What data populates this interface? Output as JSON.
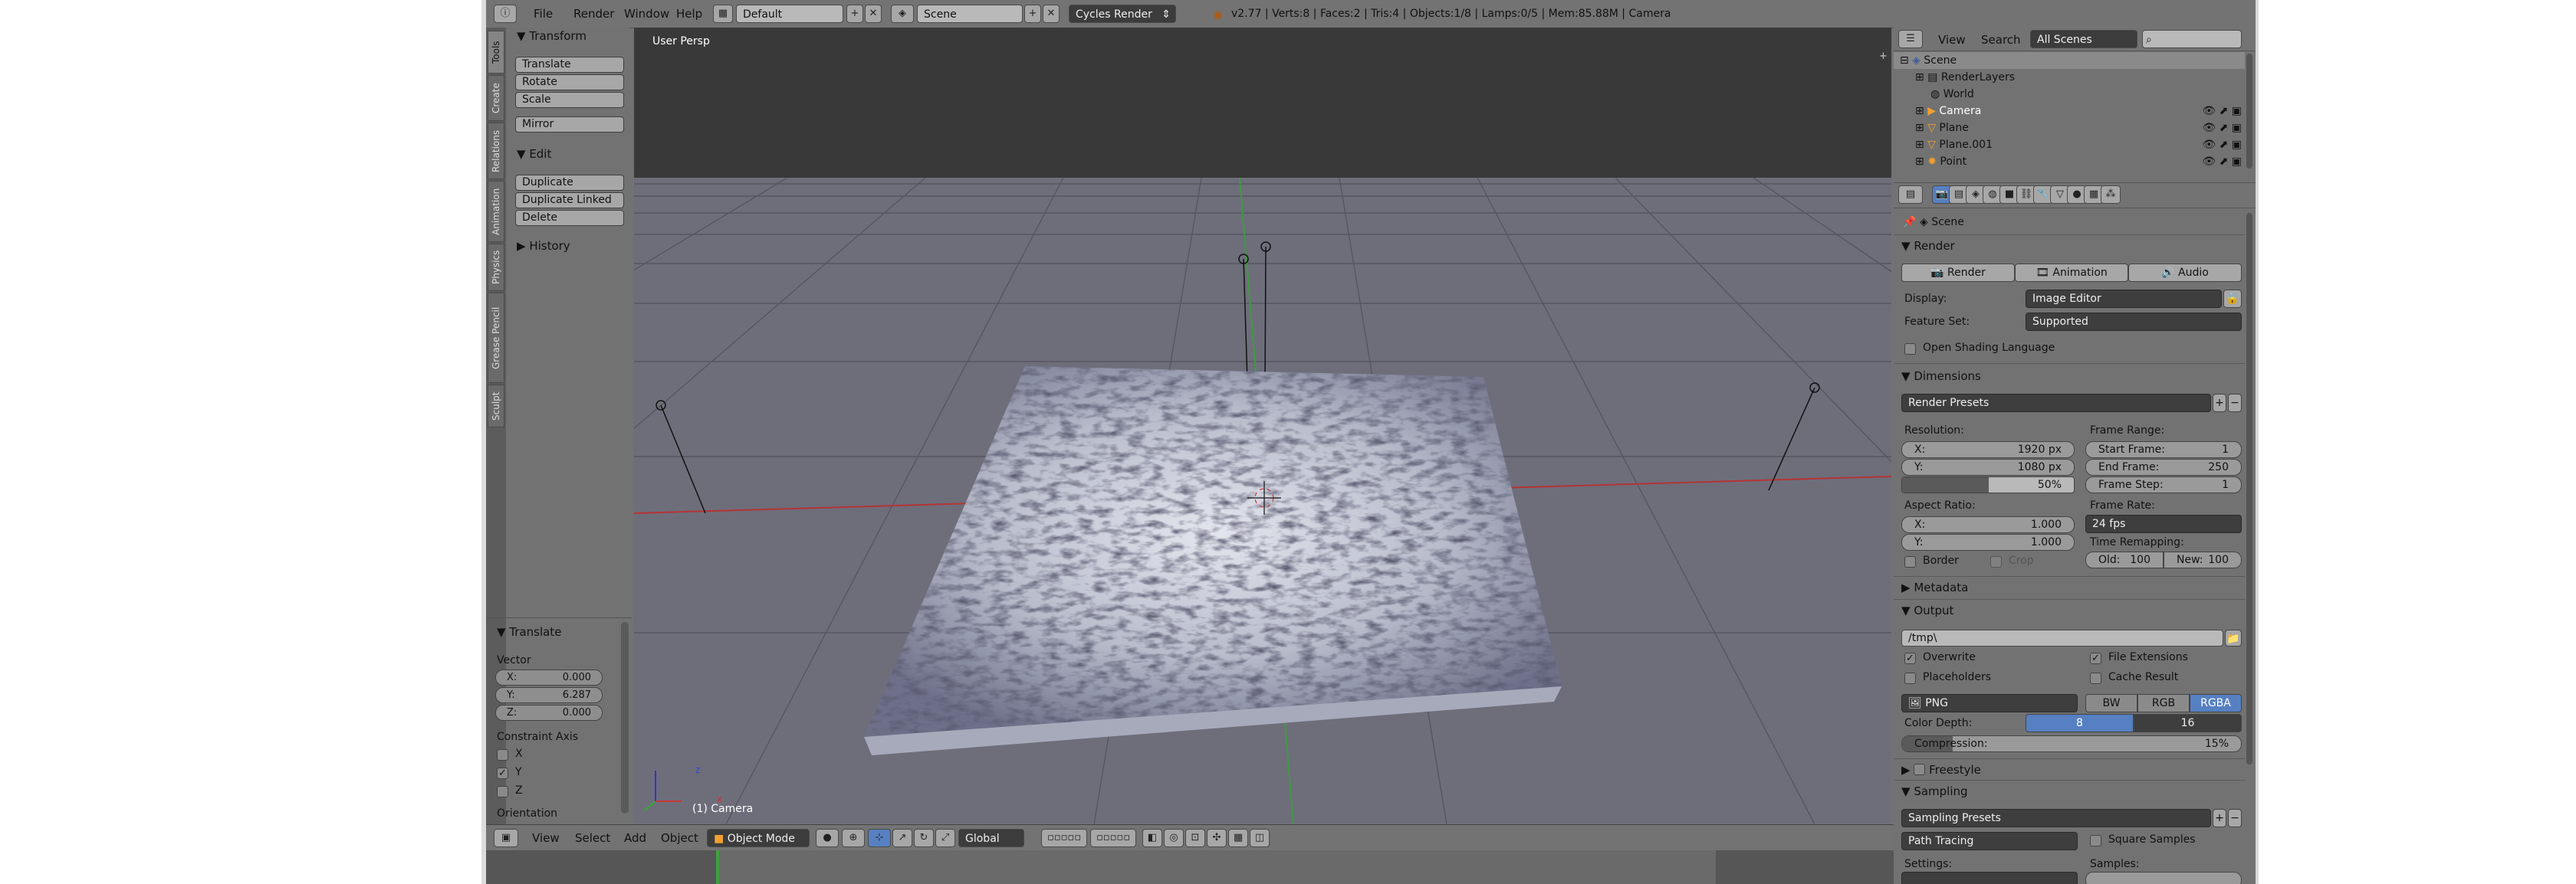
{
  "topbar": {
    "menus": [
      "File",
      "Render",
      "Window",
      "Help"
    ],
    "layout": "Default",
    "scene": "Scene",
    "engine": "Cycles Render",
    "stats": "v2.77 | Verts:8 | Faces:2 | Tris:4 | Objects:1/8 | Lamps:0/5 | Mem:85.88M | Camera"
  },
  "toolshelf": {
    "tabs": [
      "Tools",
      "Create",
      "Relations",
      "Animation",
      "Physics",
      "Grease Pencil",
      "Sculpt"
    ],
    "transform_header": "Transform",
    "transform_buttons": [
      "Translate",
      "Rotate",
      "Scale"
    ],
    "mirror": "Mirror",
    "edit_header": "Edit",
    "edit_buttons": [
      "Duplicate",
      "Duplicate Linked",
      "Delete"
    ],
    "history_header": "History"
  },
  "operator": {
    "header": "Translate",
    "vector_label": "Vector",
    "x_label": "X:",
    "x_value": "0.000",
    "y_label": "Y:",
    "y_value": "6.287",
    "z_label": "Z:",
    "z_value": "0.000",
    "constraint_label": "Constraint Axis",
    "axes": [
      "X",
      "Y",
      "Z"
    ],
    "orientation_label": "Orientation"
  },
  "viewport": {
    "view_name": "User Persp",
    "object_label": "(1) Camera",
    "axis_x": "x",
    "axis_z": "z"
  },
  "header3d": {
    "menus": [
      "View",
      "Select",
      "Add",
      "Object"
    ],
    "mode": "Object Mode",
    "orientation": "Global"
  },
  "outliner": {
    "menus": [
      "View",
      "Search"
    ],
    "filter": "All Scenes",
    "rows": [
      "Scene",
      "RenderLayers",
      "World",
      "Camera",
      "Plane",
      "Plane.001",
      "Point"
    ]
  },
  "properties": {
    "scene_label": "Scene",
    "render_header": "Render",
    "render_btn": "Render",
    "animation_btn": "Animation",
    "audio_btn": "Audio",
    "display_label": "Display:",
    "display_value": "Image Editor",
    "featureset_label": "Feature Set:",
    "featureset_value": "Supported",
    "osl_label": "Open Shading Language",
    "dimensions_header": "Dimensions",
    "render_presets": "Render Presets",
    "resolution_label": "Resolution:",
    "res_x_label": "X:",
    "res_x": "1920 px",
    "res_y_label": "Y:",
    "res_y": "1080 px",
    "res_pct": "50%",
    "frame_range_label": "Frame Range:",
    "start_label": "Start Frame:",
    "start_value": "1",
    "end_label": "End Frame:",
    "end_value": "250",
    "step_label": "Frame Step:",
    "step_value": "1",
    "aspect_label": "Aspect Ratio:",
    "asp_x_label": "X:",
    "asp_x": "1.000",
    "asp_y_label": "Y:",
    "asp_y": "1.000",
    "framerate_label": "Frame Rate:",
    "framerate_value": "24 fps",
    "remap_label": "Time Remapping:",
    "old_label": "Old:",
    "old_value": "100",
    "new_label": "New:",
    "new_value": "100",
    "border_label": "Border",
    "crop_label": "Crop",
    "metadata_header": "Metadata",
    "output_header": "Output",
    "output_path": "/tmp\\",
    "overwrite_label": "Overwrite",
    "file_ext_label": "File Extensions",
    "placeholders_label": "Placeholders",
    "cache_label": "Cache Result",
    "format_value": "PNG",
    "bw": "BW",
    "rgb": "RGB",
    "rgba": "RGBA",
    "color_depth_label": "Color Depth:",
    "depth_8": "8",
    "depth_16": "16",
    "compression_label": "Compression:",
    "compression_value": "15%",
    "compression_level": 0.15,
    "freestyle_header": "Freestyle",
    "sampling_header": "Sampling",
    "sampling_presets": "Sampling Presets",
    "integrator": "Path Tracing",
    "square_samples_label": "Square Samples",
    "settings_label": "Settings:",
    "samples_label": "Samples:"
  },
  "colors": {
    "ui_bg": "#727272",
    "viewport_bg": "#393939",
    "grid_floor": "#6d6d7a",
    "x_axis": "#c03030",
    "y_axis": "#3fa040",
    "active_blue": "#5680c2",
    "selected_orange": "#f0a030"
  }
}
